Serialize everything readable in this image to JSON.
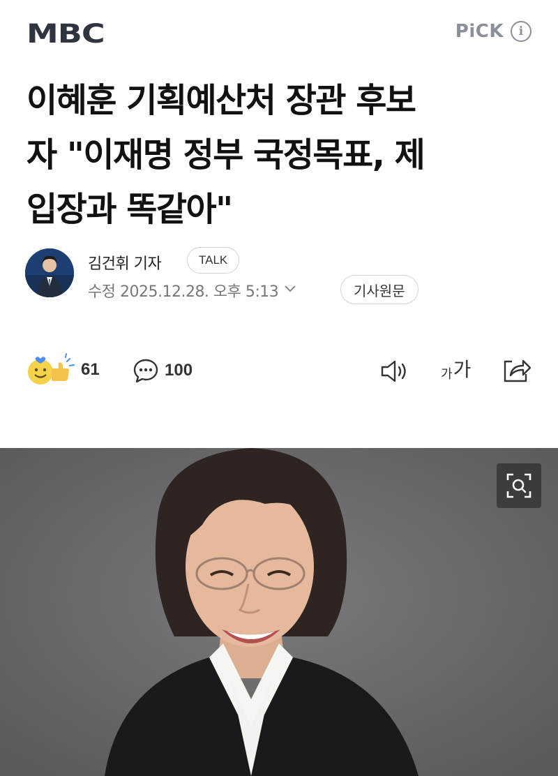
{
  "header": {
    "logo_text": "MBC",
    "pick_label": "PiCK",
    "info_icon": "info-icon"
  },
  "article": {
    "headline_lines": [
      "이혜훈 기획예산처 장관 후보",
      "자 \"이재명 정부 국정목표, 제",
      "입장과 똑같아\""
    ],
    "reporter": "김건휘 기자",
    "talk_label": "TALK",
    "date": "수정 2025.12.28. 오후 5:13",
    "original_label": "기사원문"
  },
  "actions": {
    "reaction_count": "61",
    "comment_count": "100",
    "font_small": "가",
    "font_large": "가",
    "icons": [
      "reaction-icon",
      "comment-icon",
      "speaker-icon",
      "font-size-icon",
      "share-icon"
    ]
  },
  "photo": {
    "zoom_icon": "zoom-icon"
  },
  "colors": {
    "logo": "#2f3440",
    "muted": "#8a8f99",
    "photo_bg": "#6a6a6c"
  }
}
